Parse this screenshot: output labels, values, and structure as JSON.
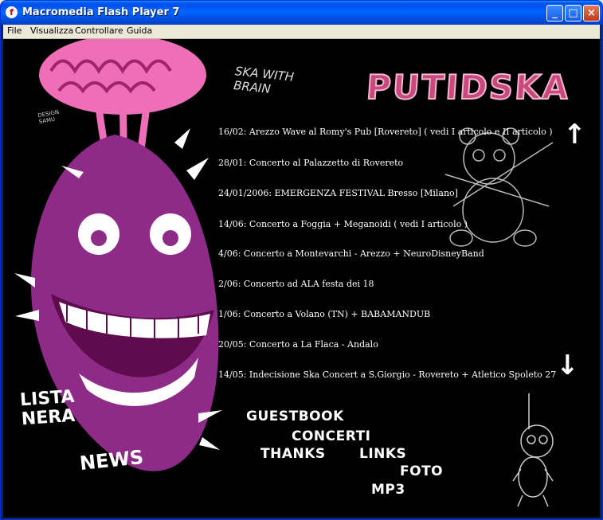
{
  "window": {
    "title": "Macromedia Flash Player 7",
    "icon": "flash-player-icon",
    "controls": {
      "minimize": "_",
      "maximize": "□",
      "close": "×"
    }
  },
  "menu": [
    "File",
    "Visualizza",
    "Controllare",
    "Guida"
  ],
  "header": {
    "logo_text": "PUTIDSKA",
    "tagline_line1": "SKA WITH",
    "tagline_line2": "BRAIN",
    "signature_line1": "DESIGN",
    "signature_line2": "SAMU"
  },
  "news": [
    "16/02: Arezzo Wave al Romy's Pub [Rovereto] ( vedi I articolo e II articolo )",
    "28/01: Concerto al Palazzetto di Rovereto",
    "24/01/2006: EMERGENZA FESTIVAL Bresso [Milano]",
    "14/06: Concerto a Foggia + Meganoidi ( vedi I articolo )",
    "4/06: Concerto a Montevarchi - Arezzo + NeuroDisneyBand",
    "2/06: Concerto ad ALA festa dei 18",
    "1/06: Concerto a Volano (TN) + BABAMANDUB",
    "20/05: Concerto a La Flaca - Andalo",
    "14/05: Indecisione Ska Concert a S.Giorgio - Rovereto + Atletico Spoleto 27"
  ],
  "scroll": {
    "up": "↑",
    "down": "↓"
  },
  "side_labels": {
    "lista_line1": "LISTA",
    "lista_line2": "NERA",
    "news": "NEWS"
  },
  "nav": {
    "guestbook": "GUESTBOOK",
    "concerti": "CONCERTI",
    "thanks": "THANKS",
    "links": "LINKS",
    "foto": "FOTO",
    "mp3": "MP3"
  },
  "colors": {
    "accent_pink": "#c9487e",
    "mascot_purple": "#8e2a88",
    "brain_pink": "#ee6fb8"
  }
}
